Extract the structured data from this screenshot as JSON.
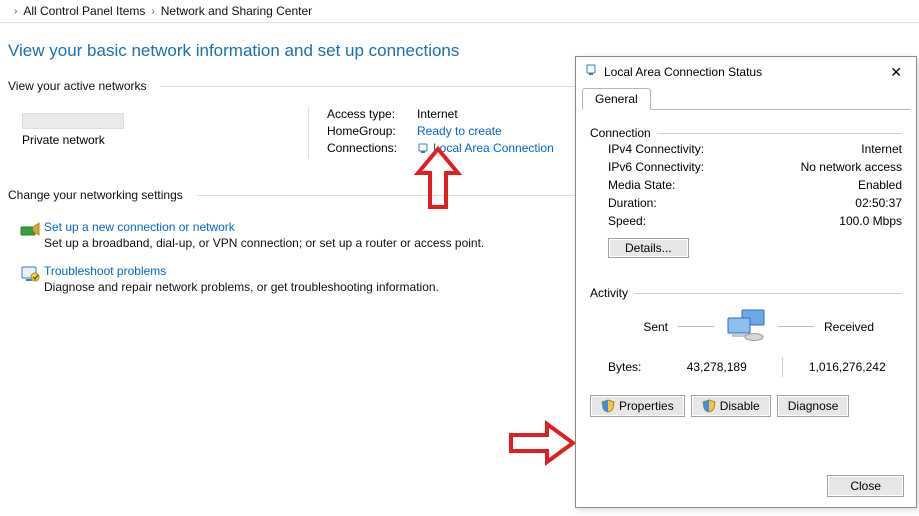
{
  "breadcrumb": {
    "item1": "All Control Panel Items",
    "item2": "Network and Sharing Center"
  },
  "heading": "View your basic network information and set up connections",
  "active_networks_label": "View your active networks",
  "network": {
    "category": "Private network",
    "access_type_label": "Access type:",
    "access_type_value": "Internet",
    "homegroup_label": "HomeGroup:",
    "homegroup_value": "Ready to create",
    "connections_label": "Connections:",
    "connection_name": "Local Area Connection"
  },
  "settings_label": "Change your networking settings",
  "settings": [
    {
      "title": "Set up a new connection or network",
      "desc": "Set up a broadband, dial-up, or VPN connection; or set up a router or access point."
    },
    {
      "title": "Troubleshoot problems",
      "desc": "Diagnose and repair network problems, or get troubleshooting information."
    }
  ],
  "dialog": {
    "title": "Local Area Connection Status",
    "tab_general": "General",
    "group_connection": "Connection",
    "ipv4_label": "IPv4 Connectivity:",
    "ipv4_value": "Internet",
    "ipv6_label": "IPv6 Connectivity:",
    "ipv6_value": "No network access",
    "media_label": "Media State:",
    "media_value": "Enabled",
    "duration_label": "Duration:",
    "duration_value": "02:50:37",
    "speed_label": "Speed:",
    "speed_value": "100.0 Mbps",
    "details": "Details...",
    "group_activity": "Activity",
    "sent_label": "Sent",
    "received_label": "Received",
    "bytes_label": "Bytes:",
    "bytes_sent": "43,278,189",
    "bytes_recv": "1,016,276,242",
    "btn_properties": "Properties",
    "btn_disable": "Disable",
    "btn_diagnose": "Diagnose",
    "btn_close": "Close"
  }
}
